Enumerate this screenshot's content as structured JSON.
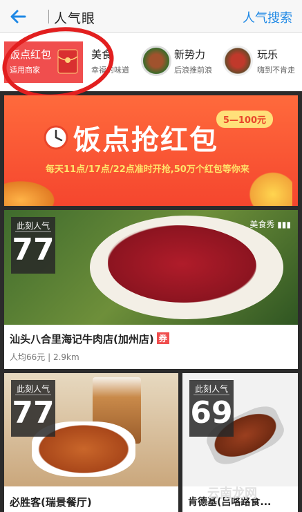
{
  "header": {
    "title": "人气眼",
    "search_label": "人气搜索"
  },
  "categories": [
    {
      "name": "饭点红包",
      "sub": "适用商家"
    },
    {
      "name": "美食",
      "sub": "幸福的味道"
    },
    {
      "name": "新势力",
      "sub": "后浪推前浪"
    },
    {
      "name": "玩乐",
      "sub": "嗨到不肯走"
    }
  ],
  "banner": {
    "title": "饭点抢红包",
    "badge": "5—100元",
    "subtitle": "每天11点/17点/22点准时开抢,50万个红包等你来"
  },
  "cards": [
    {
      "pop_label": "此刻人气",
      "pop_value": "77",
      "tag": "美食秀",
      "name": "汕头八合里海记牛肉店(加州店)",
      "coupon": "券",
      "meta": "人均66元 | 2.9km"
    },
    {
      "pop_label": "此刻人气",
      "pop_value": "77",
      "name": "必胜客(瑞景餐厅)"
    },
    {
      "pop_label": "此刻人气",
      "pop_value": "69",
      "name": "肯德基(吕咯路食..."
    }
  ],
  "watermark": "云南龙网"
}
